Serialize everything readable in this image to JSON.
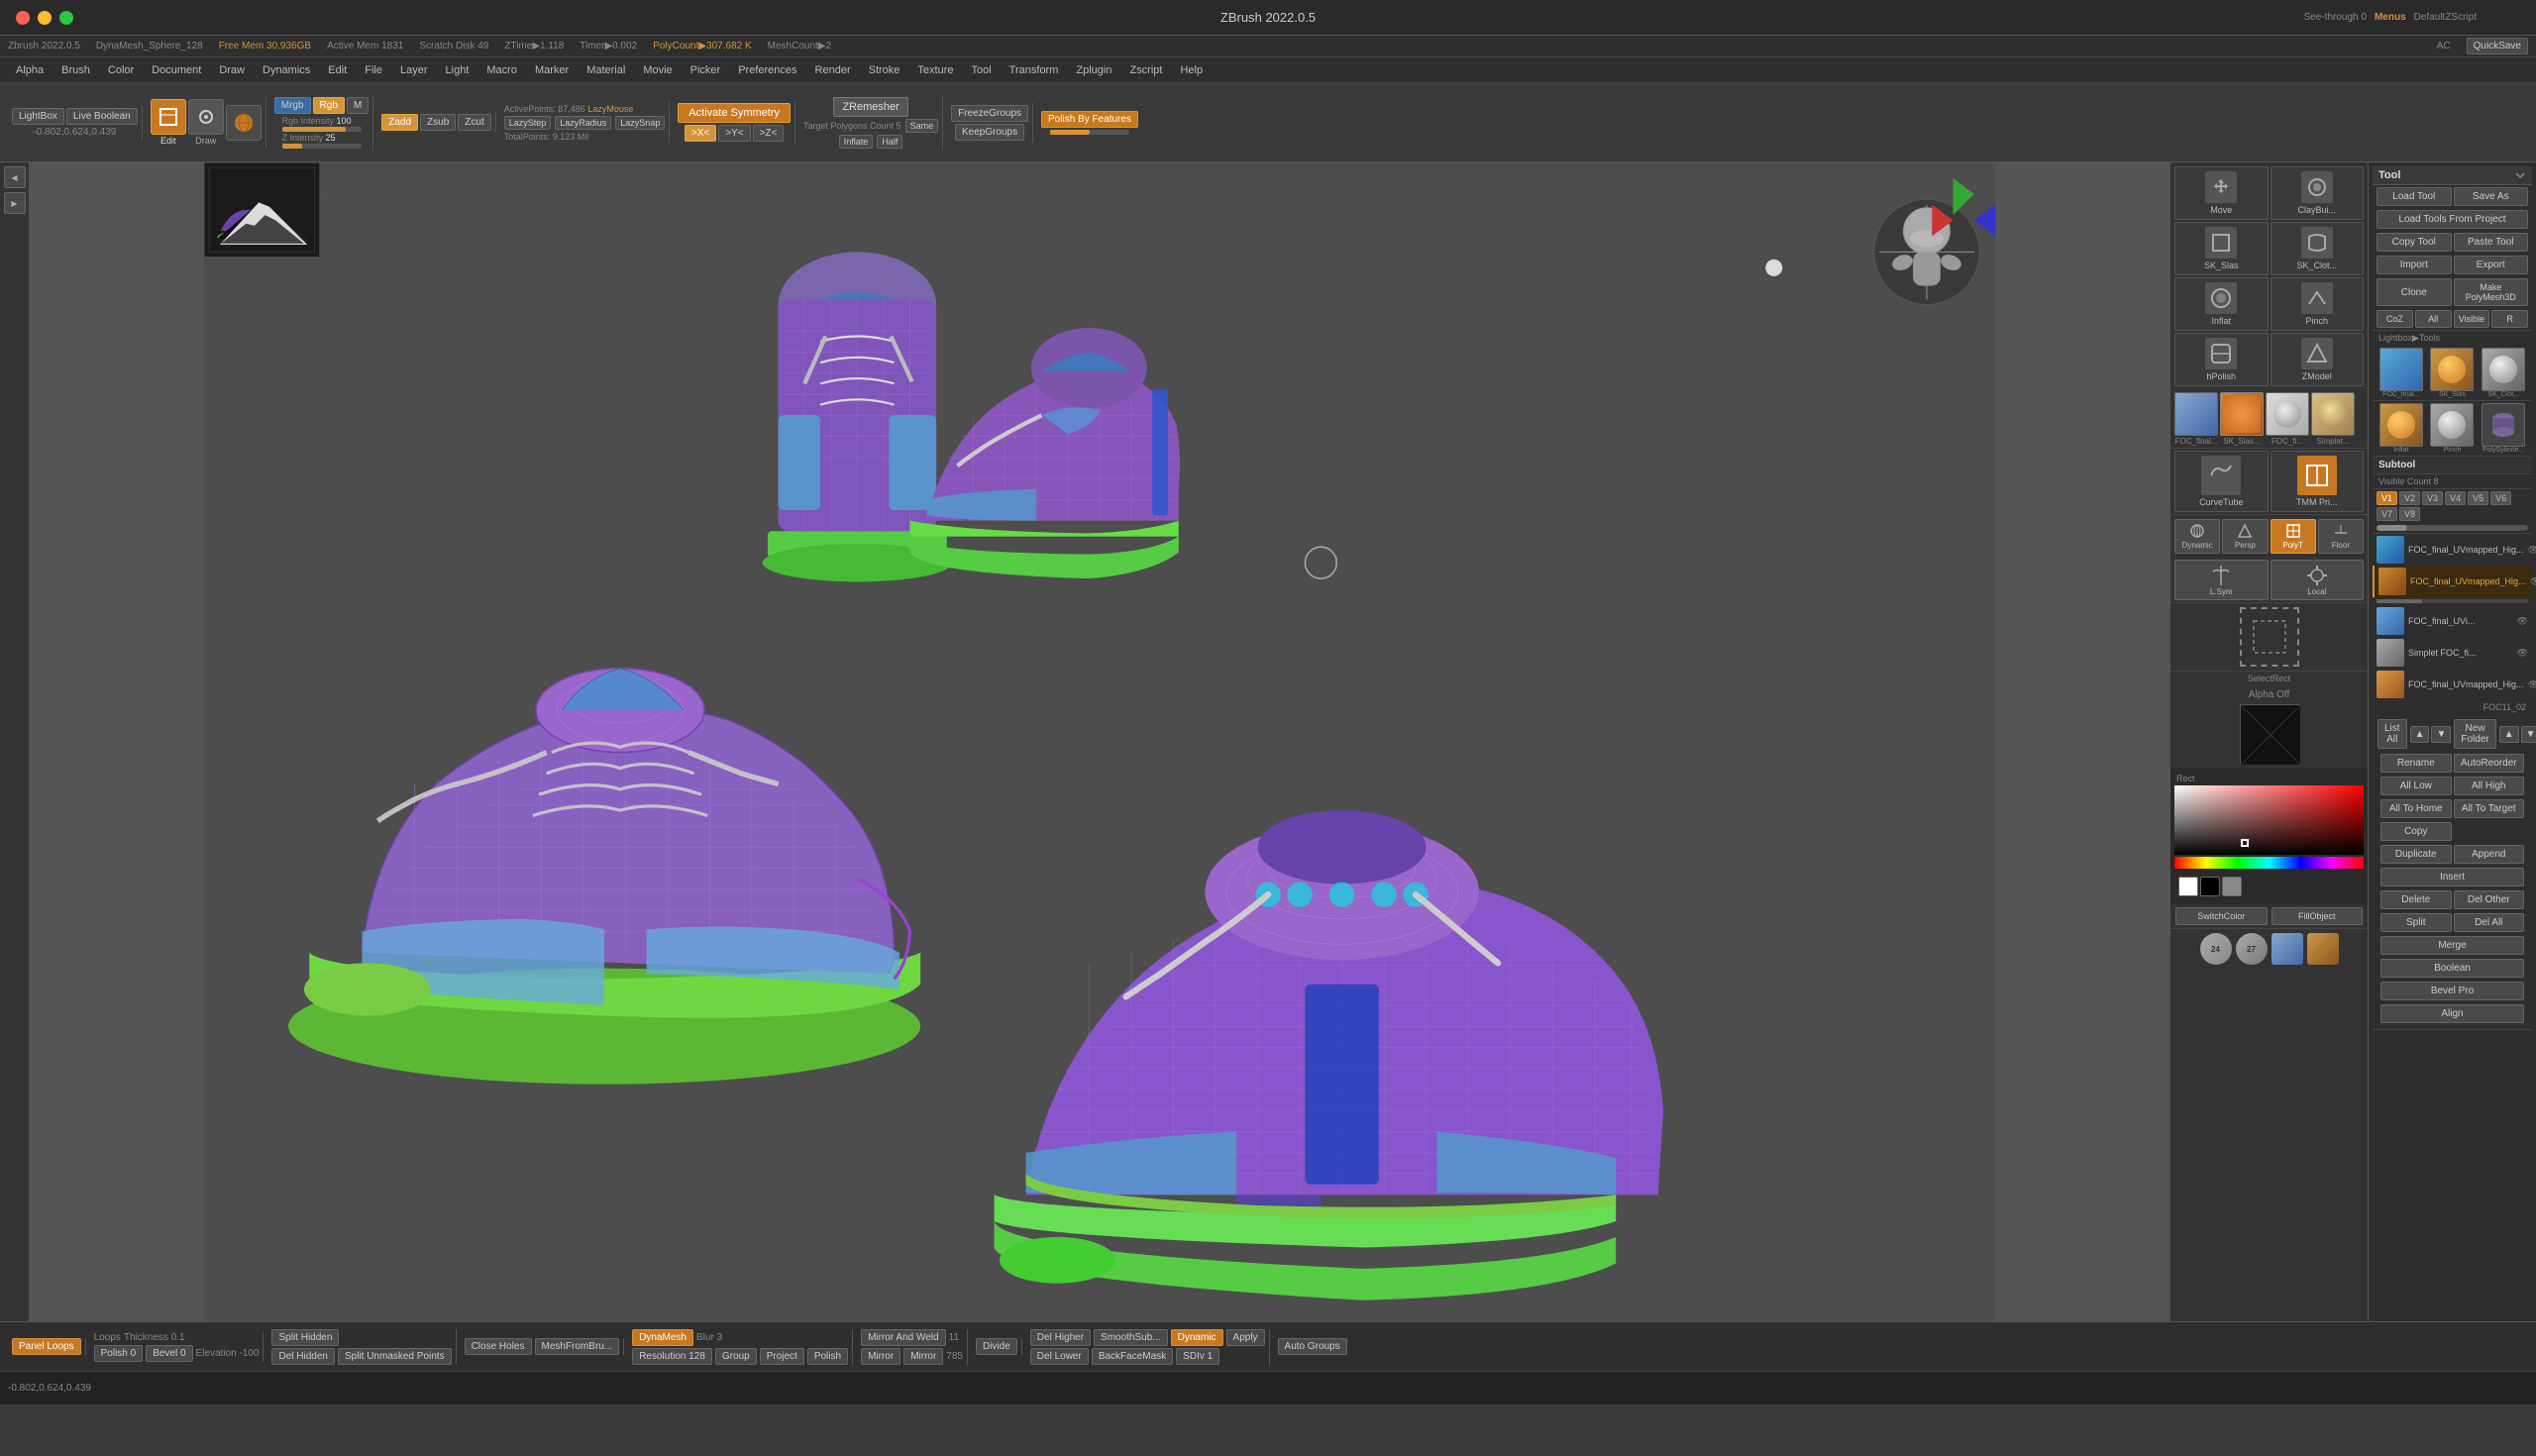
{
  "window": {
    "title": "ZBrush 2022.0.5",
    "controls": {
      "close": "●",
      "minimize": "●",
      "maximize": "●"
    }
  },
  "titlebar": {
    "text": "ZBrush 2022.0.5"
  },
  "infobar": {
    "version": "Zbrush 2022.0.5",
    "dynaMesh": "DynaMesh_Sphere_128",
    "freeMem": "Free Mem 30.936GB",
    "activeMem": "Active Mem 1831",
    "scratchDisk": "Scratch Disk 49",
    "ztime": "ZTime▶1.118",
    "timer": "Timer▶0.002",
    "polyCount": "PolyCount▶307.682 K",
    "meshCount": "MeshCount▶2",
    "quicksave": "QuickSave",
    "seethrough": "See-through  0",
    "menus": "Menus",
    "defaultScript": "DefaultZScript"
  },
  "menubar": {
    "items": [
      "Alpha",
      "Brush",
      "Color",
      "Document",
      "Draw",
      "Dynamics",
      "Edit",
      "File",
      "Layer",
      "Light",
      "Macro",
      "Marker",
      "Material",
      "Movie",
      "Picker",
      "Preferences",
      "Render",
      "Stroke",
      "Texture",
      "Tool",
      "Transform",
      "Zplugin",
      "Zscript",
      "Help"
    ]
  },
  "toolbar": {
    "lightbox": "LightBox",
    "liveBoolean": "Live Boolean",
    "edit_label": "Edit",
    "draw_label": "Draw",
    "mrgb": "Mrgb",
    "rgb": "Rgb",
    "m": "M",
    "zadd": "Zadd",
    "zsub": "Zsub",
    "zcut": "Zcut",
    "rgbIntensity": "Rgb Intensity 100",
    "zIntensity": "Z Intensity 25",
    "activePoints": "ActivePoints: 87,486",
    "lazyMouse": "LazyMouse",
    "lazyStep": "LazyStep",
    "lazyRadius": "LazyRadius",
    "lazySnap": "LazySnap",
    "totalPoints": "TotalPoints: 9.123 Mil",
    "activateSymmetry": "Activate Symmetry",
    "xSymm": ">X<",
    "ySymm": ">Y<",
    "zSymm": ">Z<",
    "zRemesher": "ZRemesher",
    "targetPolygons": "Target Polygons Count 5",
    "same": "Same",
    "inflate": "Inflate",
    "half": "Half",
    "freezeGroups": "FreezeGroups",
    "keepGroups": "KeepGroups",
    "polishByFeatures": "Polish By Features"
  },
  "coordinates": {
    "text": "-0.802,0.624,0.439"
  },
  "rightPanel": {
    "sections": {
      "move": "Move",
      "clayBuild": "ClayBui...",
      "sk_slas": "SK_Slas",
      "sk_cloth": "SK_Clot...",
      "inflat": "Inflat",
      "pinch": "Pinch",
      "hPolish": "hPolish",
      "zmodel": "ZModel",
      "curveTube": "CurveTube",
      "tmmPrim": "TMM Pri...",
      "dynamic": "Dynamic",
      "persp": "Persp",
      "polyT": "PolyT",
      "floor": "Floor",
      "lSym": "L.Sym",
      "local": "Local",
      "selectRect": "SelectRect",
      "alphaOff": "Alpha Off"
    }
  },
  "toolPanel": {
    "title": "Tool",
    "buttons": {
      "loadTool": "Load Tool",
      "saveAs": "Save As",
      "loadToolsFromProject": "Load Tools From Project",
      "copyTool": "Copy Tool",
      "pasteTool": "Paste Tool",
      "import": "Import",
      "export": "Export",
      "clone": "Clone",
      "makeMeshPoly": "Make PolyMesh3D",
      "coz": "CoZ",
      "all": "All",
      "visible": "Visible",
      "r": "R"
    },
    "subtools": {
      "header": "Subtool",
      "visibleCount": "Visible Count 8",
      "versions": [
        "V1",
        "V2",
        "V3",
        "V4",
        "V5",
        "V6",
        "V7",
        "V8"
      ],
      "activeVersion": "V1",
      "items": [
        {
          "name": "FOC_final_UVmapped_Hig...",
          "thumb": "thumb1"
        },
        {
          "name": "FOC_final_UVn Mapped_High",
          "thumb": "thumb2"
        },
        {
          "name": "FOC_final_UVi...",
          "thumb": "thumb3"
        },
        {
          "name": "Simplet FOC_fi...",
          "thumb": "thumb4"
        },
        {
          "name": "FOC_final_UVmapped_Hig...",
          "thumb": "thumb5",
          "selected": true
        },
        {
          "name": "FOC11_02",
          "thumb": "thumb6"
        }
      ]
    },
    "listButtons": {
      "listAll": "List All",
      "newFolder": "New Folder",
      "rename": "Rename",
      "autoReorder": "AutoReorder",
      "allLow": "All Low",
      "allHigh": "All High",
      "allToHome": "All To Home",
      "allToTarget": "All To Target",
      "copy": "Copy",
      "duplicate": "Duplicate",
      "append": "Append",
      "insert": "Insert",
      "delete": "Delete",
      "delOther": "Del Other",
      "split": "Split",
      "delAll": "Del All",
      "merge": "Merge",
      "boolean": "Boolean",
      "bevelPro": "Bevel Pro",
      "align": "Align"
    },
    "colorSection": {
      "rect": "Rect",
      "switchColor": "SwitchColor",
      "fillObject": "FillObject"
    },
    "subDiv": {
      "nums": [
        "24",
        "27"
      ]
    }
  },
  "bottomToolbar": {
    "panelLoops": "Panel Loops",
    "loops": "Loops",
    "thickness": "Thickness 0",
    "thickness_val": "0.1",
    "elevation": "Elevation",
    "elevation_val": "-100",
    "polish": "Polish",
    "bevel": "Bevel 0",
    "splitHidden": "Split Hidden",
    "delHidden": "Del Hidden",
    "splitUnmasked": "Split Unmasked Points",
    "closeHoles": "Close Holes",
    "meshFromBrush": "MeshFromBru...",
    "dynaMesh": "DynaMesh",
    "blur": "Blur",
    "blurVal": "3",
    "resolution": "Resolution 128",
    "group": "Group",
    "project": "Project",
    "mirrorAndWeld": "Mirror And Weld",
    "mirrorVal": "11",
    "mirror": "Mirror",
    "mirrorBtn": "Mirror",
    "mirrorVal2": "785",
    "divide": "Divide",
    "delHigher": "Del Higher",
    "delLower": "Del Lower",
    "smoothSubDiv": "SmoothSub...",
    "sdivVal": "SDIv 1",
    "dynamic": "Dynamic",
    "apply": "Apply",
    "backFaceMask": "BackFaceMask",
    "autoGroups": "Auto Groups"
  },
  "statusBar": {
    "coord": "-0.802,0.624,0.439"
  },
  "colors": {
    "orange": "#c87820",
    "orangeLight": "#d4943a",
    "blue": "#3a6ca0",
    "green": "#4aaa44",
    "darkBg": "#2a2a2a",
    "panelBg": "#333",
    "accent": "#d4943a"
  }
}
